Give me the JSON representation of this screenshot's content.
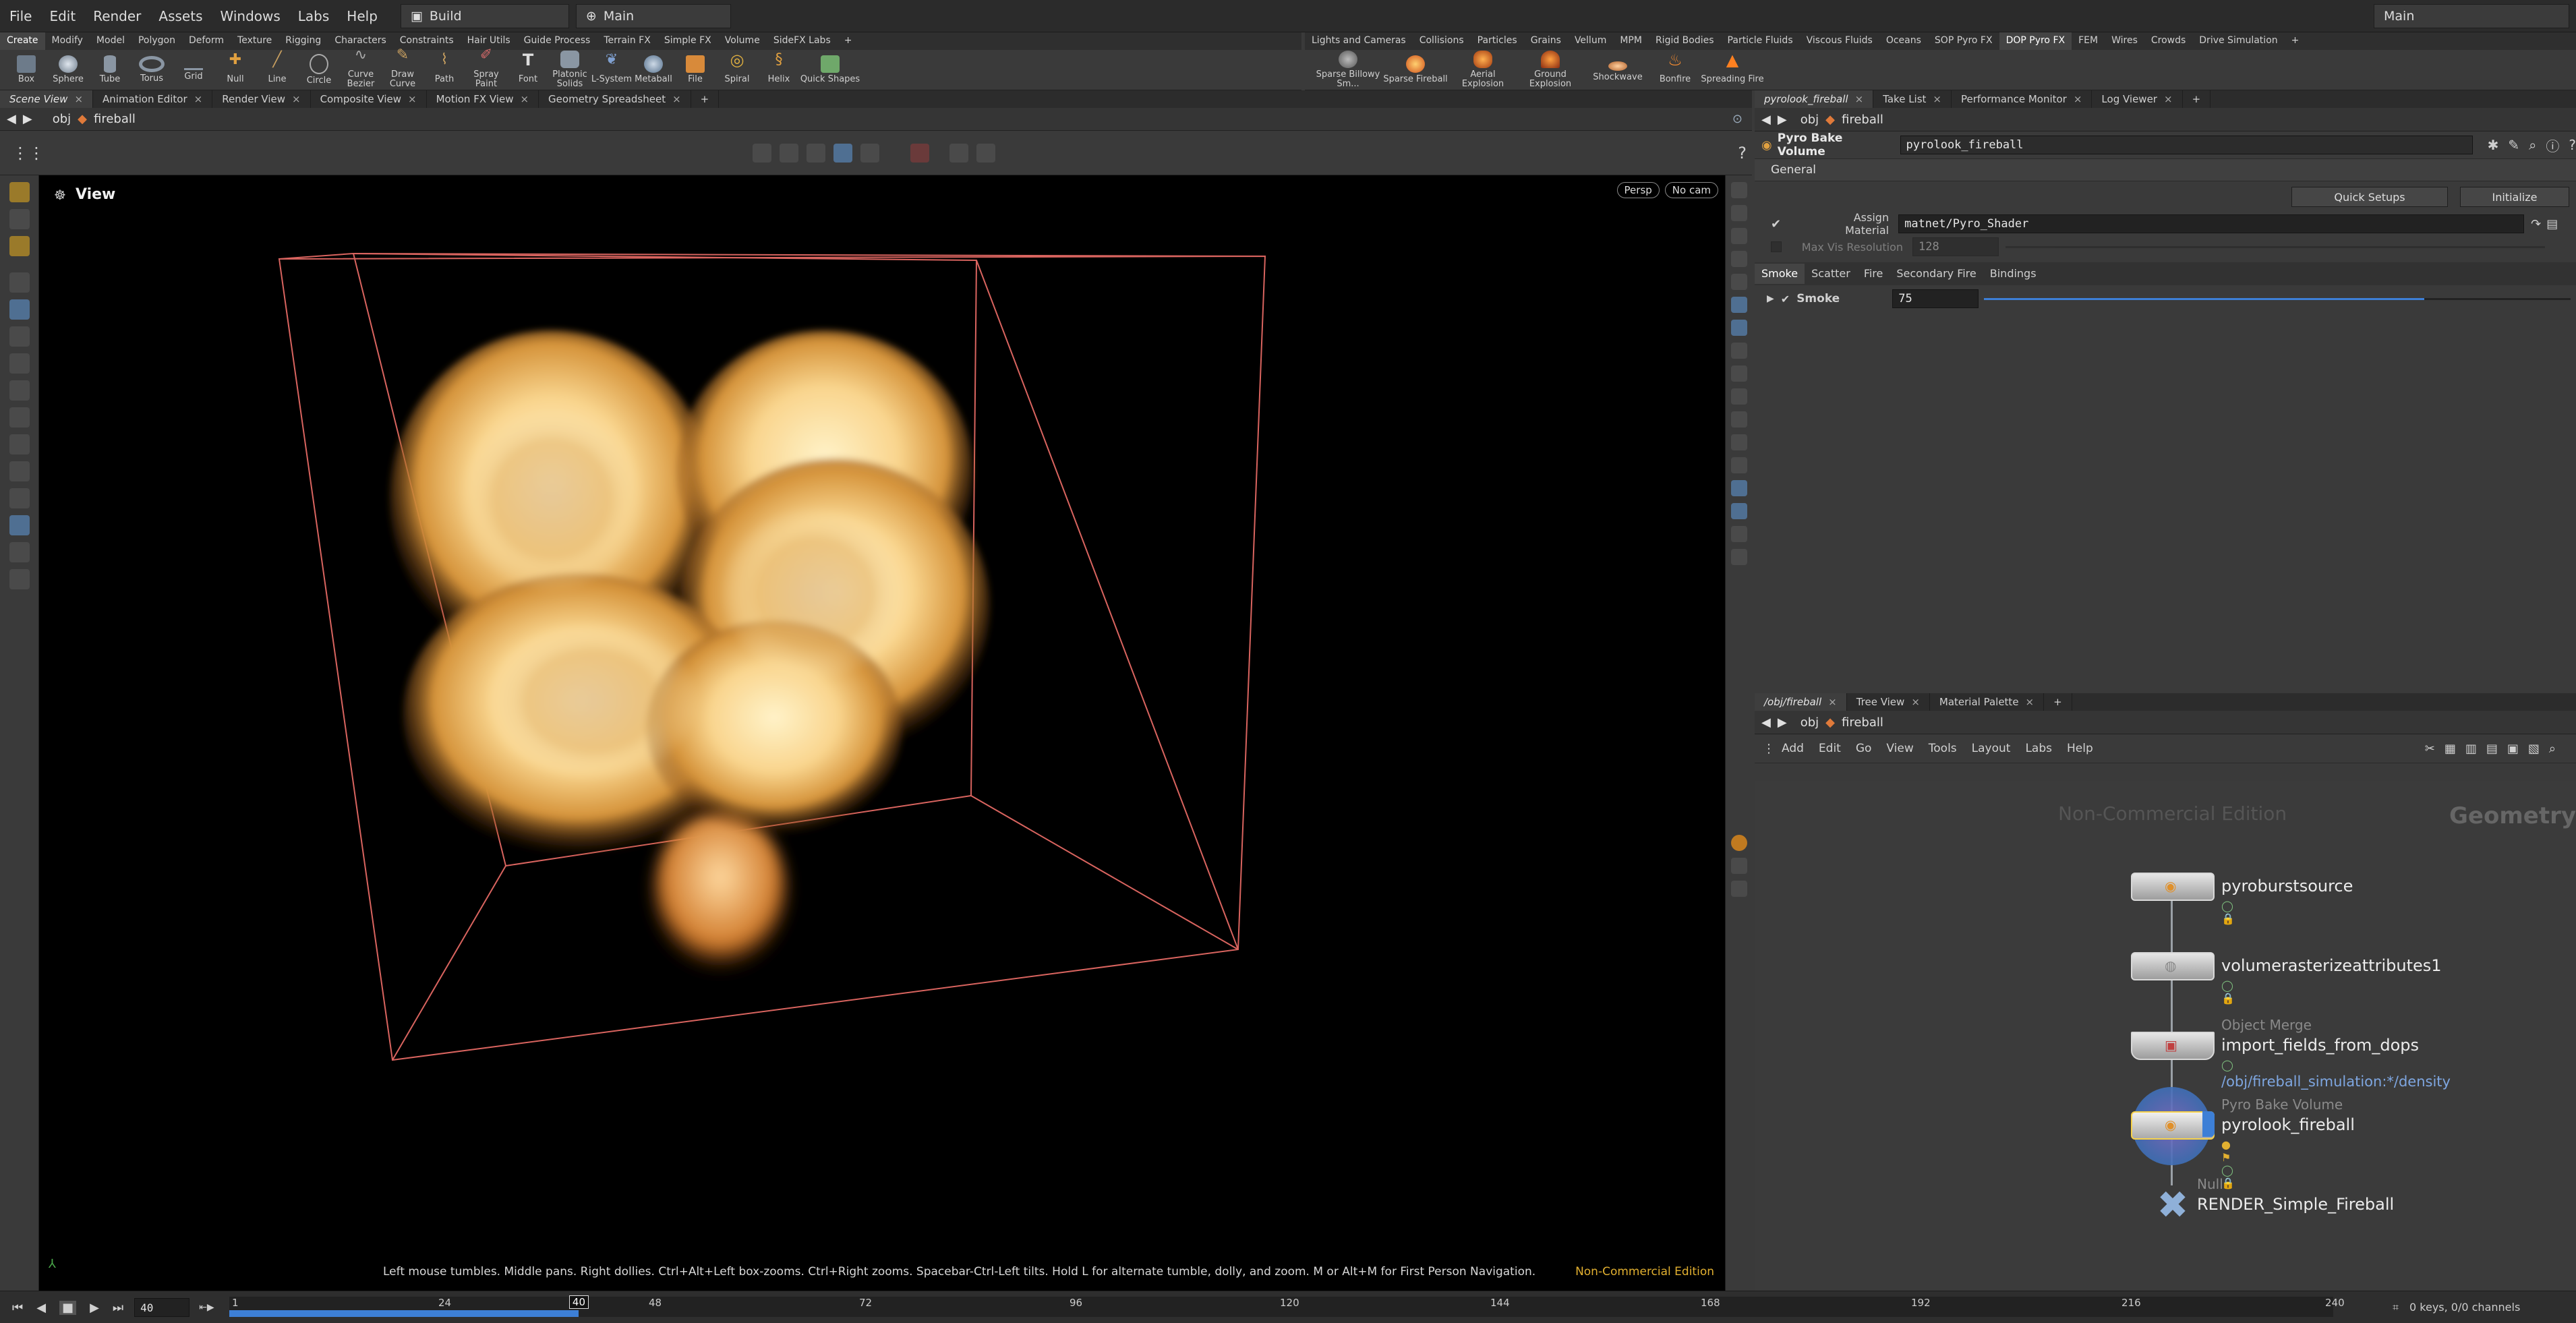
{
  "menubar": {
    "items": [
      "File",
      "Edit",
      "Render",
      "Assets",
      "Windows",
      "Labs",
      "Help"
    ],
    "desktop": "Build",
    "context": "Main",
    "right_label": "Main"
  },
  "shelf_left": {
    "tabs": [
      "Create",
      "Modify",
      "Model",
      "Polygon",
      "Deform",
      "Texture",
      "Rigging",
      "Characters",
      "Constraints",
      "Hair Utils",
      "Guide Process",
      "Terrain FX",
      "Simple FX",
      "Volume",
      "SideFX Labs"
    ],
    "tools": [
      "Box",
      "Sphere",
      "Tube",
      "Torus",
      "Grid",
      "Null",
      "Line",
      "Circle",
      "Curve Bezier",
      "Draw Curve",
      "Path",
      "Spray Paint",
      "Font",
      "Platonic Solids",
      "L-System",
      "Metaball",
      "File",
      "Spiral",
      "Helix",
      "Quick Shapes"
    ]
  },
  "shelf_right": {
    "tabs": [
      "Lights and Cameras",
      "Collisions",
      "Particles",
      "Grains",
      "Vellum",
      "MPM",
      "Rigid Bodies",
      "Particle Fluids",
      "Viscous Fluids",
      "Oceans",
      "SOP Pyro FX",
      "DOP Pyro FX",
      "FEM",
      "Wires",
      "Crowds",
      "Drive Simulation"
    ],
    "active_tab": "DOP Pyro FX",
    "tools": [
      "Sparse Billowy Sm...",
      "Sparse Fireball",
      "Aerial Explosion",
      "Ground Explosion",
      "Shockwave",
      "Bonfire",
      "Spreading Fire"
    ]
  },
  "left_panetabs": [
    "Scene View",
    "Animation Editor",
    "Render View",
    "Composite View",
    "Motion FX View",
    "Geometry Spreadsheet"
  ],
  "left_path": {
    "obj": "obj",
    "node": "fireball"
  },
  "viewport": {
    "title": "View",
    "persp": "Persp",
    "cam": "No cam",
    "hint": "Left mouse tumbles. Middle pans. Right dollies. Ctrl+Alt+Left box-zooms. Ctrl+Right zooms. Spacebar-Ctrl-Left tilts. Hold L for alternate tumble, dolly, and zoom. M or Alt+M for First Person Navigation.",
    "edition": "Non-Commercial Edition"
  },
  "timeline": {
    "frame": "40",
    "start": "1",
    "ticks": [
      "24",
      "48",
      "72",
      "96",
      "120",
      "144",
      "168",
      "192",
      "216",
      "240"
    ],
    "current_frame_marker": "40",
    "playback_fraction": 0.166,
    "keys_status": "0 keys, 0/0 channels"
  },
  "param_pane": {
    "tabs": [
      "pyrolook_fireball",
      "Take List",
      "Performance Monitor",
      "Log Viewer"
    ],
    "path": {
      "obj": "obj",
      "node": "fireball"
    },
    "node_type": "Pyro Bake Volume",
    "node_name": "pyrolook_fireball",
    "section": "General",
    "quick_setups": "Quick Setups",
    "initialize": "Initialize",
    "assign_material_label": "Assign Material",
    "assign_material_value": "matnet/Pyro_Shader",
    "max_vis_label": "Max Vis Resolution",
    "max_vis_value": "128",
    "subtabs": [
      "Smoke",
      "Scatter",
      "Fire",
      "Secondary Fire",
      "Bindings"
    ],
    "smoke_label": "Smoke",
    "smoke_value": "75",
    "smoke_fraction": 0.75
  },
  "net_pane": {
    "tabs": [
      "/obj/fireball",
      "Tree View",
      "Material Palette"
    ],
    "path": {
      "obj": "obj",
      "node": "fireball"
    },
    "menu": [
      "Add",
      "Edit",
      "Go",
      "View",
      "Tools",
      "Layout",
      "Labs",
      "Help"
    ],
    "watermark": "Non-Commercial Edition",
    "context_label": "Geometry",
    "nodes": [
      {
        "type": "",
        "name": "pyroburstsource"
      },
      {
        "type": "",
        "name": "volumerasterizeattributes1"
      },
      {
        "type": "Object Merge",
        "name": "import_fields_from_dops",
        "sub": "/obj/fireball_simulation:*/density"
      },
      {
        "type": "Pyro Bake Volume",
        "name": "pyrolook_fireball"
      },
      {
        "type": "Null",
        "name": "RENDER_Simple_Fireball"
      }
    ]
  },
  "colors": {
    "accent": "#4f6f92",
    "selection": "#f7d24a",
    "box_lines": "#d9645f",
    "timeline_fill": "#3d7fd6"
  }
}
